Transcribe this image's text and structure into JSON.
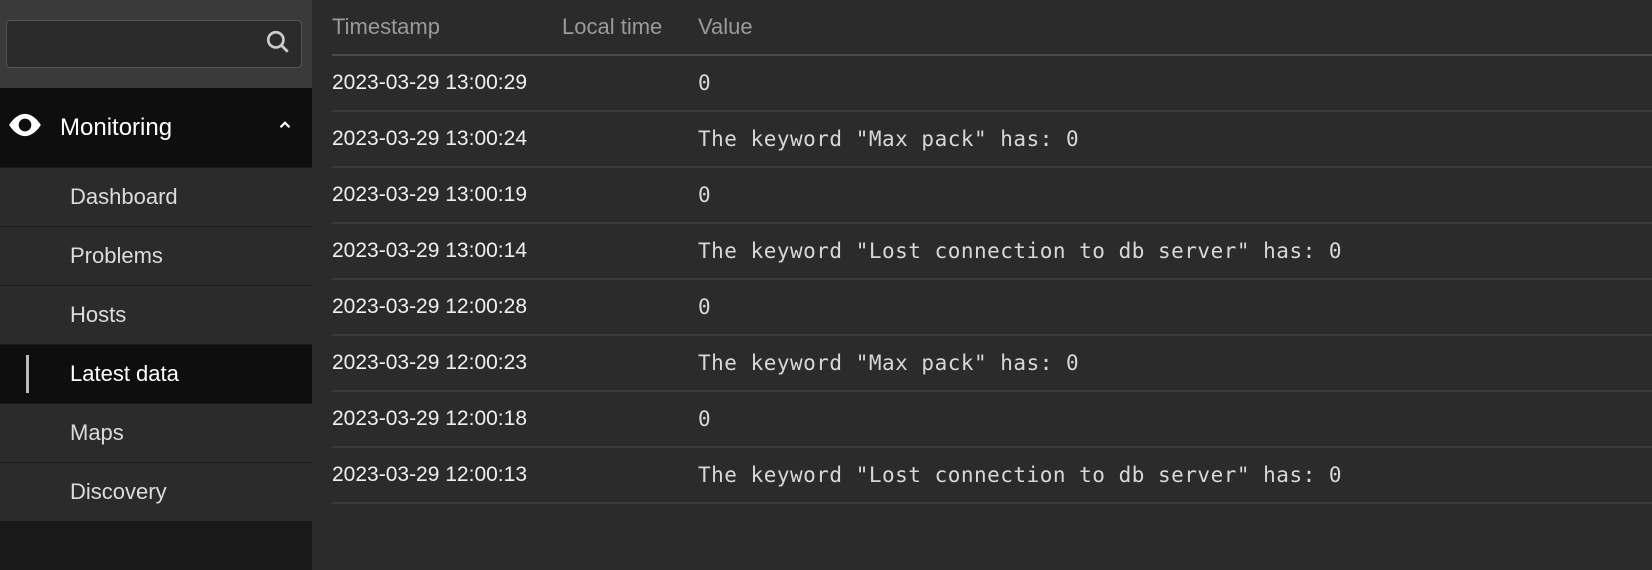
{
  "sidebar": {
    "search_placeholder": "",
    "section": {
      "title": "Monitoring",
      "items": [
        {
          "label": "Dashboard",
          "active": false
        },
        {
          "label": "Problems",
          "active": false
        },
        {
          "label": "Hosts",
          "active": false
        },
        {
          "label": "Latest data",
          "active": true
        },
        {
          "label": "Maps",
          "active": false
        },
        {
          "label": "Discovery",
          "active": false
        }
      ]
    }
  },
  "table": {
    "headers": {
      "timestamp": "Timestamp",
      "local_time": "Local time",
      "value": "Value"
    },
    "rows": [
      {
        "timestamp": "2023-03-29 13:00:29",
        "local_time": "",
        "value": "0"
      },
      {
        "timestamp": "2023-03-29 13:00:24",
        "local_time": "",
        "value": "The keyword \"Max pack\" has: 0"
      },
      {
        "timestamp": "2023-03-29 13:00:19",
        "local_time": "",
        "value": "0"
      },
      {
        "timestamp": "2023-03-29 13:00:14",
        "local_time": "",
        "value": "The keyword \"Lost connection to db server\" has: 0"
      },
      {
        "timestamp": "2023-03-29 12:00:28",
        "local_time": "",
        "value": "0"
      },
      {
        "timestamp": "2023-03-29 12:00:23",
        "local_time": "",
        "value": "The keyword \"Max pack\" has: 0"
      },
      {
        "timestamp": "2023-03-29 12:00:18",
        "local_time": "",
        "value": "0"
      },
      {
        "timestamp": "2023-03-29 12:00:13",
        "local_time": "",
        "value": "The keyword \"Lost connection to db server\" has: 0"
      }
    ]
  }
}
